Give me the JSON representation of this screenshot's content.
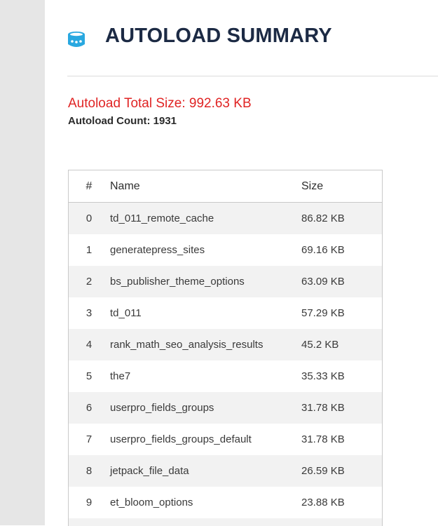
{
  "header": {
    "title": "AUTOLOAD SUMMARY",
    "icon": "database-icon",
    "icon_color": "#29a8e0"
  },
  "summary": {
    "total_size": "Autoload Total Size: 992.63 KB",
    "count": "Autoload Count: 1931",
    "total_color": "#e02424"
  },
  "table": {
    "columns": [
      "#",
      "Name",
      "Size"
    ],
    "rows": [
      {
        "idx": "0",
        "name": "td_011_remote_cache",
        "size": "86.82 KB"
      },
      {
        "idx": "1",
        "name": "generatepress_sites",
        "size": "69.16 KB"
      },
      {
        "idx": "2",
        "name": "bs_publisher_theme_options",
        "size": "63.09 KB"
      },
      {
        "idx": "3",
        "name": "td_011",
        "size": "57.29 KB"
      },
      {
        "idx": "4",
        "name": "rank_math_seo_analysis_results",
        "size": "45.2 KB"
      },
      {
        "idx": "5",
        "name": "the7",
        "size": "35.33 KB"
      },
      {
        "idx": "6",
        "name": "userpro_fields_groups",
        "size": "31.78 KB"
      },
      {
        "idx": "7",
        "name": "userpro_fields_groups_default",
        "size": "31.78 KB"
      },
      {
        "idx": "8",
        "name": "jetpack_file_data",
        "size": "26.59 KB"
      },
      {
        "idx": "9",
        "name": "et_bloom_options",
        "size": "23.88 KB"
      }
    ]
  }
}
